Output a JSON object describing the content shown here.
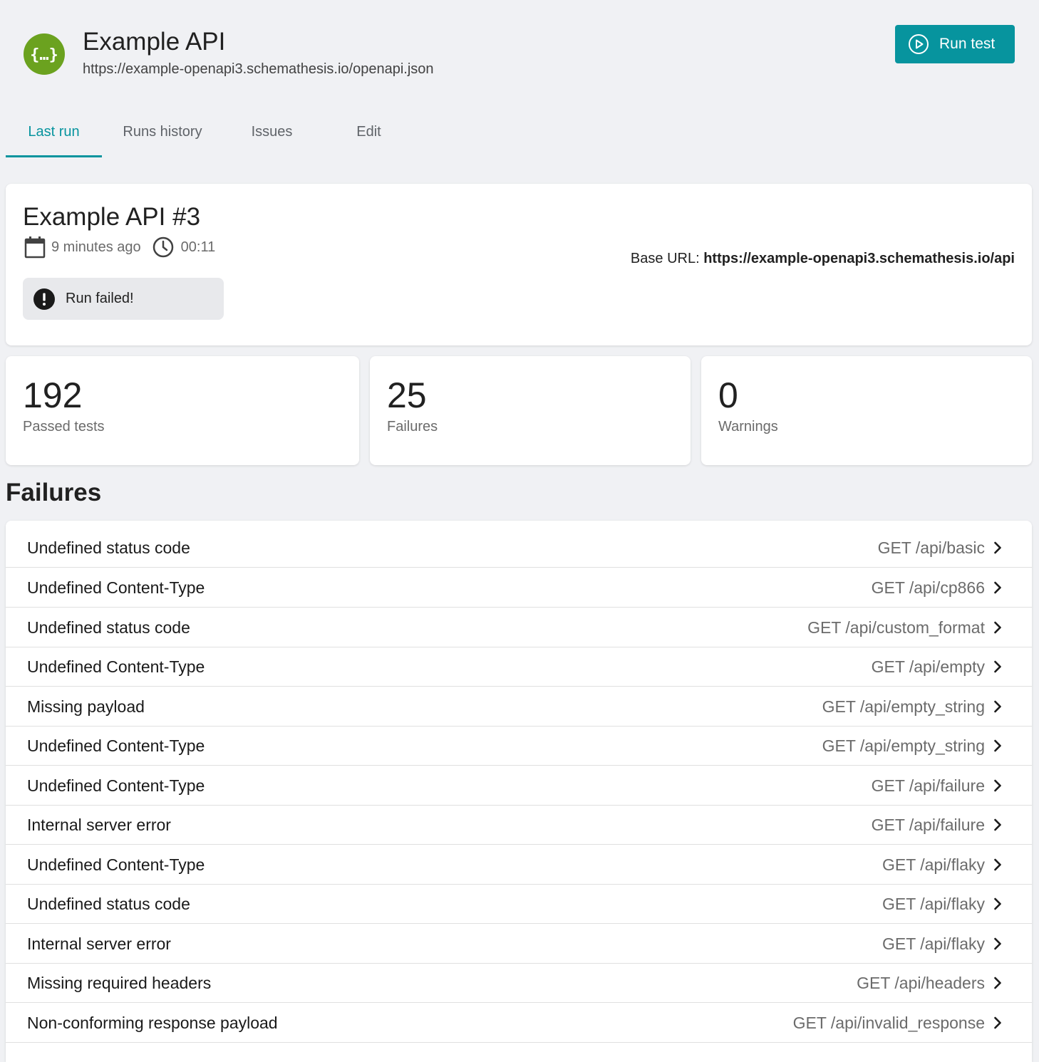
{
  "header": {
    "title": "Example API",
    "url": "https://example-openapi3.schemathesis.io/openapi.json",
    "logo_icon": "openapi-braces-icon",
    "run_button_label": "Run test"
  },
  "tabs": [
    {
      "label": "Last run",
      "active": true
    },
    {
      "label": "Runs history",
      "active": false
    },
    {
      "label": "Issues",
      "active": false
    },
    {
      "label": "Edit",
      "active": false
    }
  ],
  "run": {
    "title": "Example API #3",
    "started": "9 minutes ago",
    "duration": "00:11",
    "base_url_label": "Base URL:",
    "base_url": "https://example-openapi3.schemathesis.io/api",
    "status": "Run failed!"
  },
  "stats": {
    "passed": {
      "value": "192",
      "label": "Passed tests"
    },
    "failures": {
      "value": "25",
      "label": "Failures"
    },
    "warnings": {
      "value": "0",
      "label": "Warnings"
    }
  },
  "failures_section": {
    "title": "Failures",
    "items": [
      {
        "name": "Undefined status code",
        "endpoint": "GET /api/basic"
      },
      {
        "name": "Undefined Content-Type",
        "endpoint": "GET /api/cp866"
      },
      {
        "name": "Undefined status code",
        "endpoint": "GET /api/custom_format"
      },
      {
        "name": "Undefined Content-Type",
        "endpoint": "GET /api/empty"
      },
      {
        "name": "Missing payload",
        "endpoint": "GET /api/empty_string"
      },
      {
        "name": "Undefined Content-Type",
        "endpoint": "GET /api/empty_string"
      },
      {
        "name": "Undefined Content-Type",
        "endpoint": "GET /api/failure"
      },
      {
        "name": "Internal server error",
        "endpoint": "GET /api/failure"
      },
      {
        "name": "Undefined Content-Type",
        "endpoint": "GET /api/flaky"
      },
      {
        "name": "Undefined status code",
        "endpoint": "GET /api/flaky"
      },
      {
        "name": "Internal server error",
        "endpoint": "GET /api/flaky"
      },
      {
        "name": "Missing required headers",
        "endpoint": "GET /api/headers"
      },
      {
        "name": "Non-conforming response payload",
        "endpoint": "GET /api/invalid_response"
      }
    ]
  },
  "colors": {
    "accent": "#07949e",
    "logo": "#6ba21f",
    "background": "#f0f1f4"
  }
}
